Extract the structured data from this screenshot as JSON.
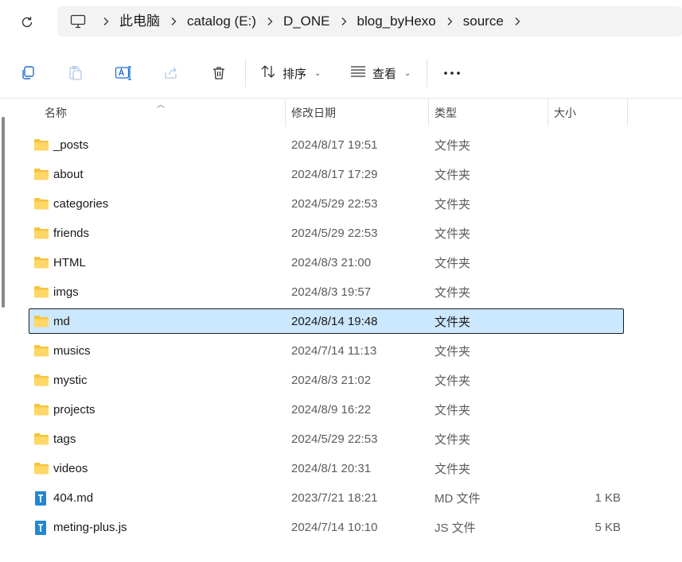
{
  "address": {
    "root_icon": "computer-icon",
    "crumbs": [
      "此电脑",
      "catalog (E:)",
      "D_ONE",
      "blog_byHexo",
      "source"
    ]
  },
  "toolbar": {
    "copy_icon": "copy-icon",
    "paste_icon": "paste-icon",
    "rename_icon": "rename-icon",
    "share_icon": "share-icon",
    "delete_icon": "delete-icon",
    "sort_label": "排序",
    "view_label": "查看",
    "more_label": "···"
  },
  "columns": {
    "name": "名称",
    "date": "修改日期",
    "type": "类型",
    "size": "大小"
  },
  "colors": {
    "folder": "#f4c542",
    "selected_bg": "#cce8ff",
    "file_blue": "#1e88d6"
  },
  "rows": [
    {
      "name": "_posts",
      "date": "2024/8/17 19:51",
      "type": "文件夹",
      "size": "",
      "kind": "folder"
    },
    {
      "name": "about",
      "date": "2024/8/17 17:29",
      "type": "文件夹",
      "size": "",
      "kind": "folder"
    },
    {
      "name": "categories",
      "date": "2024/5/29 22:53",
      "type": "文件夹",
      "size": "",
      "kind": "folder"
    },
    {
      "name": "friends",
      "date": "2024/5/29 22:53",
      "type": "文件夹",
      "size": "",
      "kind": "folder"
    },
    {
      "name": "HTML",
      "date": "2024/8/3 21:00",
      "type": "文件夹",
      "size": "",
      "kind": "folder"
    },
    {
      "name": "imgs",
      "date": "2024/8/3 19:57",
      "type": "文件夹",
      "size": "",
      "kind": "folder"
    },
    {
      "name": "md",
      "date": "2024/8/14 19:48",
      "type": "文件夹",
      "size": "",
      "kind": "folder",
      "selected": true
    },
    {
      "name": "musics",
      "date": "2024/7/14 11:13",
      "type": "文件夹",
      "size": "",
      "kind": "folder"
    },
    {
      "name": "mystic",
      "date": "2024/8/3 21:02",
      "type": "文件夹",
      "size": "",
      "kind": "folder"
    },
    {
      "name": "projects",
      "date": "2024/8/9 16:22",
      "type": "文件夹",
      "size": "",
      "kind": "folder"
    },
    {
      "name": "tags",
      "date": "2024/5/29 22:53",
      "type": "文件夹",
      "size": "",
      "kind": "folder"
    },
    {
      "name": "videos",
      "date": "2024/8/1 20:31",
      "type": "文件夹",
      "size": "",
      "kind": "folder"
    },
    {
      "name": "404.md",
      "date": "2023/7/21 18:21",
      "type": "MD 文件",
      "size": "1 KB",
      "kind": "file"
    },
    {
      "name": "meting-plus.js",
      "date": "2024/7/14 10:10",
      "type": "JS 文件",
      "size": "5 KB",
      "kind": "file"
    }
  ]
}
